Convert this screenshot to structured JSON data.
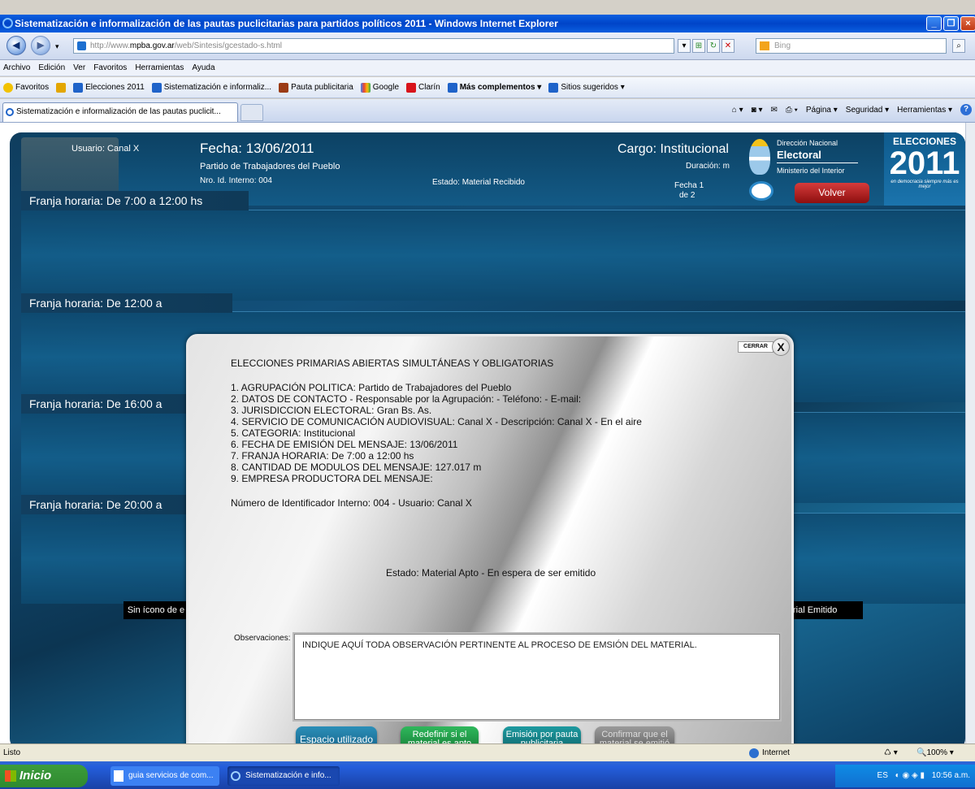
{
  "window": {
    "title": "Sistematización e informalización de las pautas puclicitarias para partidos políticos 2011 - Windows Internet Explorer"
  },
  "address": {
    "url_prefix": "http://www.",
    "url_domain": "mpba.gov.ar",
    "url_path": "/web/Sintesis/gcestado-s.html",
    "search_placeholder": "Bing"
  },
  "menu": [
    "Archivo",
    "Edición",
    "Ver",
    "Favoritos",
    "Herramientas",
    "Ayuda"
  ],
  "favorites": {
    "label": "Favoritos",
    "items": [
      "Elecciones 2011",
      "Sistematización e informaliz...",
      "Pauta publicitaria",
      "Google",
      "Clarín",
      "Más complementos ▾",
      "Sitios sugeridos ▾"
    ]
  },
  "tab": {
    "title": "Sistematización e informalización de las pautas puclicit..."
  },
  "commandbar": [
    "Página ▾",
    "Seguridad ▾",
    "Herramientas ▾"
  ],
  "page": {
    "usuario": "Usuario: Canal X",
    "fecha": "Fecha: 13/06/2011",
    "partido": "Partido de Trabajadores del Pueblo",
    "nro_id": "Nro. Id. Interno: 004",
    "estado": "Estado: Material Recibido",
    "cargo": "Cargo: Institucional",
    "duracion": "Duración: m",
    "fecha_page_1": "Fecha 1",
    "fecha_page_2": "de 2",
    "dir_line1": "Dirección Nacional",
    "dir_line2": "Electoral",
    "dir_line3": "Ministerio del Interior",
    "volver": "Volver",
    "logo_top": "ELECCIONES",
    "logo_year": "2011",
    "logo_tag": "en democracia siempre más es mejor",
    "franjas": [
      "Franja horaria: De 7:00 a 12:00 hs",
      "Franja horaria: De 12:00 a",
      "Franja horaria: De 16:00 a",
      "Franja horaria: De 20:00 a"
    ],
    "sin_icono": "Sin ícono de e",
    "material_emitido": "rial Emitido"
  },
  "modal": {
    "cerrar": "CERRAR",
    "close_x": "X",
    "heading": "ELECCIONES PRIMARIAS ABIERTAS SIMULTÁNEAS Y OBLIGATORIAS",
    "lines": [
      "1. AGRUPACIÓN POLITICA: Partido de Trabajadores del Pueblo",
      "2. DATOS DE CONTACTO - Responsable por la Agrupación:  - Teléfono:  - E-mail:",
      "3. JURISDICCION ELECTORAL: Gran Bs. As.",
      "4. SERVICIO DE COMUNICACIÓN AUDIOVISUAL: Canal X - Descripción: Canal X - En el aire",
      "5. CATEGORIA:  Institucional",
      "6. FECHA DE EMISIÓN DEL MENSAJE: 13/06/2011",
      "7. FRANJA HORARIA: De 7:00 a 12:00 hs",
      "8. CANTIDAD DE MODULOS DEL MENSAJE:  127.017 m",
      "9. EMPRESA PRODUCTORA DEL MENSAJE:"
    ],
    "identificador": "Número de Identificador Interno: 004 - Usuario: Canal X",
    "estado": "Estado: Material Apto - En espera de ser emitido",
    "obs_label": "Observaciones:",
    "obs_text": "INDIQUE AQUÍ TODA OBSERVACIÓN PERTINENTE AL PROCESO DE EMSIÓN DEL MATERIAL.",
    "btn_espacio": "Espacio utilizado",
    "btn_redefinir": "Redefinir si el material es apto",
    "btn_emision": "Emisión por pauta publicitaria",
    "btn_confirmar": "Confirmar que el material se emitió"
  },
  "status": {
    "text": "Listo",
    "zone": "Internet",
    "zoom": "100%"
  },
  "taskbar": {
    "start": "Inicio",
    "items": [
      "guia servicios de com...",
      "Sistematización e info..."
    ],
    "lang": "ES",
    "time": "10:56 a.m."
  }
}
